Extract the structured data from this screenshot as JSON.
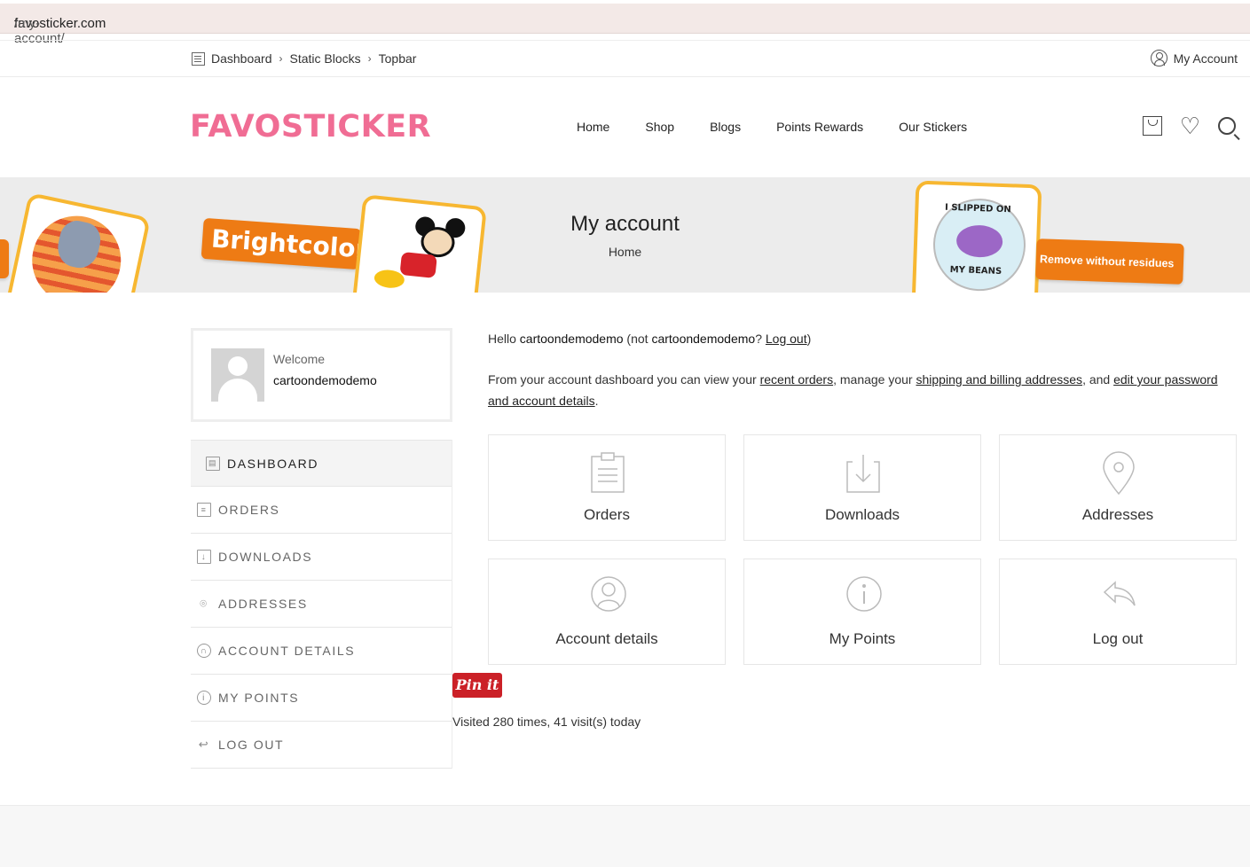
{
  "browser": {
    "domain": "favosticker.com",
    "path": "/my-account/"
  },
  "topbar": {
    "breadcrumbs": [
      "Dashboard",
      "Static Blocks",
      "Topbar"
    ],
    "my_account": "My Account"
  },
  "header": {
    "logo": "FAVOSTICKER",
    "nav": [
      "Home",
      "Shop",
      "Blogs",
      "Points Rewards",
      "Our Stickers"
    ],
    "brand_color": "#f06d94"
  },
  "banner": {
    "title": "My account",
    "crumb": "Home",
    "sticker_text_left": "Brightcolor",
    "sticker_text_right": "Remove without residues",
    "badge_top": "I SLIPPED ON",
    "badge_bottom": "MY BEANS"
  },
  "welcome": {
    "label": "Welcome",
    "username": "cartoondemodemo"
  },
  "menu": [
    {
      "label": "DASHBOARD",
      "icon": "dashboard-icon",
      "active": true
    },
    {
      "label": "ORDERS",
      "icon": "clipboard-icon",
      "active": false
    },
    {
      "label": "DOWNLOADS",
      "icon": "download-icon",
      "active": false
    },
    {
      "label": "ADDRESSES",
      "icon": "location-pin-icon",
      "active": false
    },
    {
      "label": "ACCOUNT DETAILS",
      "icon": "user-icon",
      "active": false
    },
    {
      "label": "MY POINTS",
      "icon": "info-icon",
      "active": false
    },
    {
      "label": "LOG OUT",
      "icon": "reply-icon",
      "active": false
    }
  ],
  "main": {
    "hello_prefix": "Hello ",
    "hello_user": "cartoondemodemo",
    "hello_mid": " (not ",
    "hello_user2": "cartoondemodemo",
    "hello_q": "? ",
    "logout_link": "Log out",
    "hello_end": ")",
    "intro_1": "From your account dashboard you can view your ",
    "link_orders": "recent orders",
    "intro_2": ", manage your ",
    "link_addresses": "shipping and billing addresses",
    "intro_3": ", and ",
    "link_password": "edit your password and account details",
    "intro_4": ".",
    "tiles": [
      "Orders",
      "Downloads",
      "Addresses",
      "Account details",
      "My Points",
      "Log out"
    ]
  },
  "pinit": "Pin it",
  "visits": "Visited 280 times, 41 visit(s) today"
}
